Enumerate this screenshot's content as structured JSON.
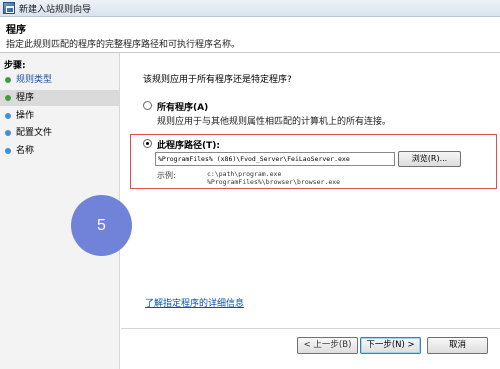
{
  "window": {
    "title": "新建入站规则向导"
  },
  "header": {
    "title": "程序",
    "description": "指定此规则匹配的程序的完整程序路径和可执行程序名称。"
  },
  "sidebar": {
    "steps_label": "步骤:",
    "items": [
      {
        "label": "规则类型",
        "state": "done"
      },
      {
        "label": "程序",
        "state": "current"
      },
      {
        "label": "操作",
        "state": "future"
      },
      {
        "label": "配置文件",
        "state": "future"
      },
      {
        "label": "名称",
        "state": "future"
      }
    ]
  },
  "main": {
    "question": "该规则应用于所有程序还是特定程序?",
    "all_programs": {
      "label": "所有程序(A)",
      "description": "规则应用于与其他规则属性相匹配的计算机上的所有连接。",
      "checked": false
    },
    "this_program": {
      "label": "此程序路径(T):",
      "checked": true,
      "path_value": "%ProgramFiles% (x86)\\Fvod_Server\\FeiLaoServer.exe",
      "browse_label": "浏览(R)...",
      "example_label": "示例:",
      "example_lines": [
        "c:\\path\\program.exe",
        "%ProgramFiles%\\browser\\browser.exe"
      ]
    },
    "learn_more": "了解指定程序的详细信息",
    "step_badge": "5"
  },
  "footer": {
    "back": "< 上一步(B)",
    "next": "下一步(N) >",
    "cancel": "取消"
  },
  "colors": {
    "highlight_border": "#e05050",
    "badge": "#7183d8",
    "link": "#0b4fb5"
  }
}
